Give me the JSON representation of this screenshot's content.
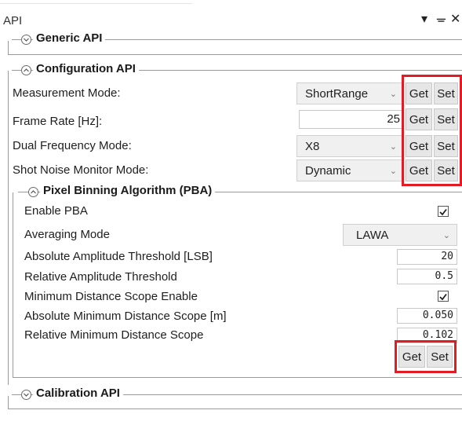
{
  "panel": {
    "title": "API",
    "dropdown_icon": "caret-down-icon",
    "pin_icon": "pin-icon",
    "close_icon": "close-icon"
  },
  "groups": {
    "generic": {
      "title": "Generic API",
      "expanded": false
    },
    "configuration": {
      "title": "Configuration API",
      "expanded": true,
      "rows": [
        {
          "label": "Measurement Mode:",
          "control": "combo",
          "value": "ShortRange",
          "get": "Get",
          "set": "Set"
        },
        {
          "label": "Frame Rate [Hz]:",
          "control": "text",
          "value": "25",
          "get": "Get",
          "set": "Set"
        },
        {
          "label": "Dual Frequency Mode:",
          "control": "combo",
          "value": "X8",
          "get": "Get",
          "set": "Set"
        },
        {
          "label": "Shot Noise Monitor Mode:",
          "control": "combo",
          "value": "Dynamic",
          "get": "Get",
          "set": "Set"
        }
      ]
    },
    "pba": {
      "title": "Pixel Binning Algorithm (PBA)",
      "expanded": true,
      "rows": [
        {
          "label": "Enable PBA",
          "control": "checkbox",
          "checked": true
        },
        {
          "label": "Averaging Mode",
          "control": "combo",
          "value": "LAWA"
        },
        {
          "label": "Absolute Amplitude Threshold [LSB]",
          "control": "text",
          "value": "20"
        },
        {
          "label": "Relative Amplitude Threshold",
          "control": "text",
          "value": "0.5"
        },
        {
          "label": "Minimum Distance Scope Enable",
          "control": "checkbox",
          "checked": true
        },
        {
          "label": "Absolute Minimum Distance Scope [m]",
          "control": "text",
          "value": "0.050"
        },
        {
          "label": "Relative Minimum Distance Scope",
          "control": "text",
          "value": "0.102"
        }
      ],
      "get": "Get",
      "set": "Set"
    },
    "calibration": {
      "title": "Calibration API",
      "expanded": false
    }
  },
  "colors": {
    "highlight": "#e31b23"
  }
}
